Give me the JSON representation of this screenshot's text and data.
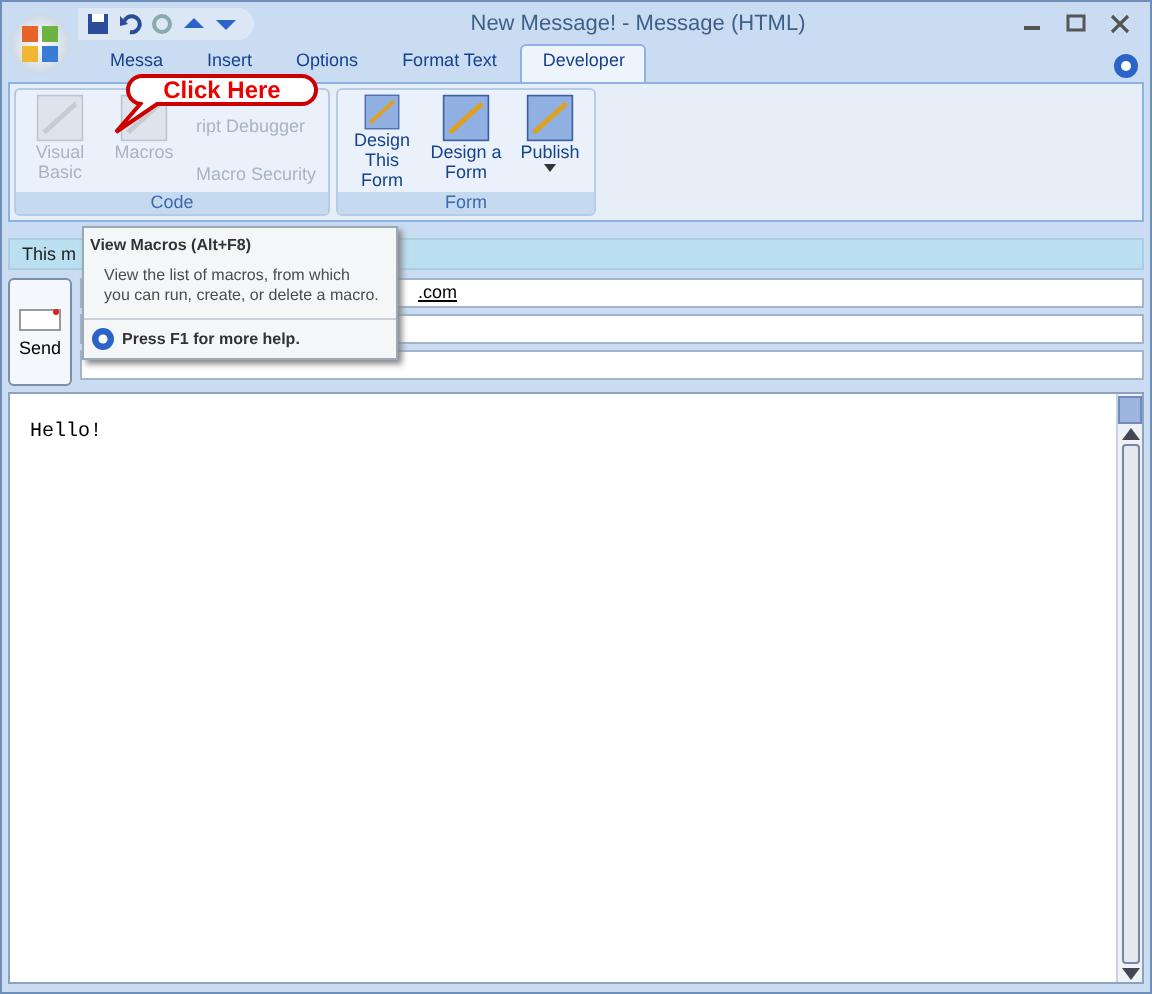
{
  "window": {
    "title": "New Message! - Message (HTML)"
  },
  "tabs": [
    {
      "label": "Messa",
      "selected": false
    },
    {
      "label": "Insert",
      "selected": false
    },
    {
      "label": "Options",
      "selected": false
    },
    {
      "label": "Format Text",
      "selected": false
    },
    {
      "label": "Developer",
      "selected": true
    }
  ],
  "ribbon_groups": [
    {
      "label": "Code",
      "buttons": [
        {
          "kind": "large",
          "label": "Visual Basic",
          "disabled": true
        },
        {
          "kind": "large",
          "label": "Macros",
          "disabled": true
        },
        {
          "kind": "small",
          "label": "ript Debugger",
          "disabled": true
        },
        {
          "kind": "small",
          "label": "Macro Security",
          "disabled": true
        }
      ]
    },
    {
      "label": "Form",
      "buttons": [
        {
          "kind": "large",
          "label": "Design This Form",
          "disabled": false
        },
        {
          "kind": "large",
          "label": "Design a Form",
          "disabled": false
        },
        {
          "kind": "large",
          "label": "Publish",
          "disabled": false,
          "dropdown": true
        }
      ]
    }
  ],
  "callout": "Click Here",
  "info_bar": "This m",
  "send_button": "Send",
  "to_field": {
    "value": ".com"
  },
  "tooltip": {
    "title": "View Macros (Alt+F8)",
    "description": "View the list of macros, from which you can run, create, or delete a macro.",
    "help": "Press F1 for more help."
  },
  "body": "Hello!"
}
